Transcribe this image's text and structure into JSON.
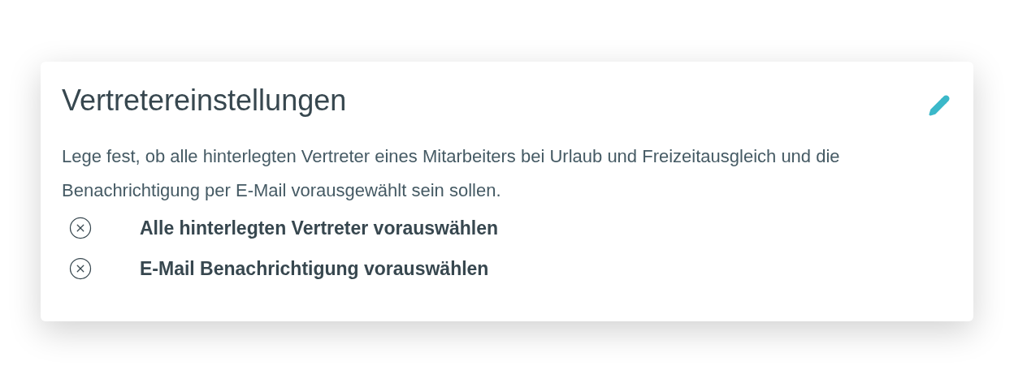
{
  "card": {
    "title": "Vertretereinstellungen",
    "description": "Lege fest, ob alle hinterlegten Vertreter eines Mitarbeiters bei Urlaub und Freizeitausgleich und die Benachrichtigung per E-Mail vorausgewählt sein sollen.",
    "settings": [
      {
        "label": "Alle hinterlegten Vertreter vorauswählen",
        "enabled": false
      },
      {
        "label": "E-Mail Benachrichtigung vorauswählen",
        "enabled": false
      }
    ]
  }
}
